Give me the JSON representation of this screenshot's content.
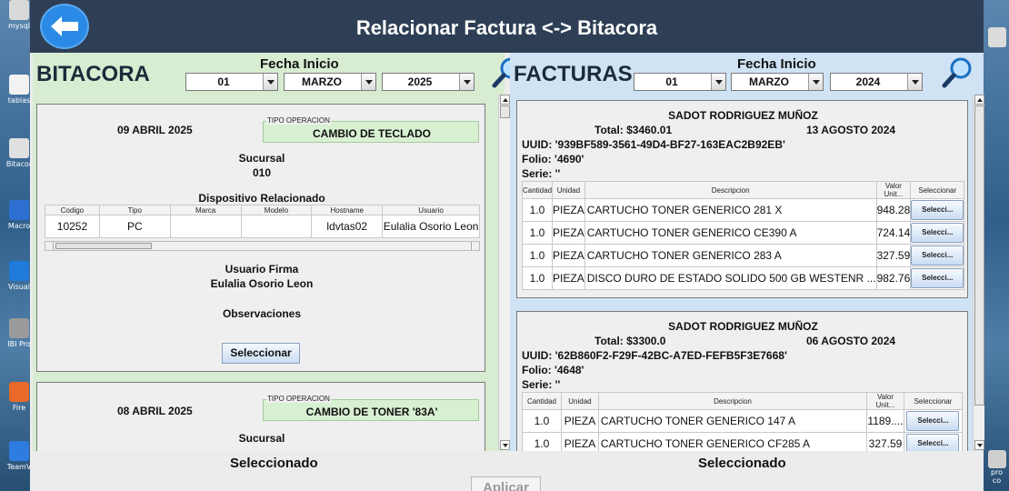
{
  "window": {
    "title": "Relacionar Factura <-> Bitacora"
  },
  "desktop_icons": [
    "mysql",
    "tablas",
    "Bitacor",
    "Macro",
    "Visual",
    "IBI Pro",
    "Fire",
    "TeamV"
  ],
  "right_icons": [
    "pro",
    "co"
  ],
  "bitacora": {
    "header": "BITACORA",
    "fecha_label": "Fecha Inicio",
    "day": "01",
    "month": "MARZO",
    "year": "2025",
    "entries": [
      {
        "date": "09 ABRIL 2025",
        "op_label": "TIPO OPERACION",
        "op_value": "CAMBIO DE TECLADO",
        "sucursal_label": "Sucursal",
        "sucursal_value": "010",
        "disp_label": "Dispositivo Relacionado",
        "columns": [
          "Codigo",
          "Tipo",
          "Marca",
          "Modelo",
          "Hostname",
          "Usuario"
        ],
        "row": [
          "10252",
          "PC",
          "",
          "",
          "ldvtas02",
          "Eulalia Osorio Leon"
        ],
        "usuario_firma_label": "Usuario Firma",
        "usuario_firma_value": "Eulalia Osorio Leon",
        "observaciones_label": "Observaciones",
        "select_label": "Seleccionar"
      },
      {
        "date": "08 ABRIL 2025",
        "op_label": "TIPO OPERACION",
        "op_value": "CAMBIO DE TONER '83A'",
        "sucursal_label": "Sucursal"
      }
    ],
    "selected_label": "Seleccionado"
  },
  "facturas": {
    "header": "FACTURAS",
    "fecha_label": "Fecha Inicio",
    "day": "01",
    "month": "MARZO",
    "year": "2024",
    "columns": [
      "Cantidad",
      "Unidad",
      "Descripcion",
      "Valor Unit...",
      "Seleccionar"
    ],
    "invoices": [
      {
        "name": "SADOT RODRIGUEZ MUÑOZ",
        "total": "Total: $3460.01",
        "date": "13 AGOSTO 2024",
        "uuid": "UUID: '939BF589-3561-49D4-BF27-163EAC2B92EB'",
        "folio": "Folio: '4690'",
        "serie": "Serie: ''",
        "items": [
          {
            "qty": "1.0",
            "unit": "PIEZA",
            "desc": "CARTUCHO TONER GENERICO  281 X",
            "val": "948.28",
            "btn": "Selecci..."
          },
          {
            "qty": "1.0",
            "unit": "PIEZA",
            "desc": "CARTUCHO TONER GENERICO  CE390 A",
            "val": "724.14",
            "btn": "Selecci..."
          },
          {
            "qty": "1.0",
            "unit": "PIEZA",
            "desc": "CARTUCHO TONER GENERICO  283 A",
            "val": "327.59",
            "btn": "Selecci..."
          },
          {
            "qty": "1.0",
            "unit": "PIEZA",
            "desc": "DISCO DURO DE ESTADO SOLIDO 500 GB  WESTENR ...",
            "val": "982.76",
            "btn": "Selecci..."
          }
        ]
      },
      {
        "name": "SADOT RODRIGUEZ MUÑOZ",
        "total": "Total: $3300.0",
        "date": "06 AGOSTO 2024",
        "uuid": "UUID: '62B860F2-F29F-42BC-A7ED-FEFB5F3E7668'",
        "folio": "Folio: '4648'",
        "serie": "Serie: ''",
        "items": [
          {
            "qty": "1.0",
            "unit": "PIEZA",
            "desc": "CARTUCHO TONER GENERICO 147 A",
            "val": "1189....",
            "btn": "Selecci..."
          },
          {
            "qty": "1.0",
            "unit": "PIEZA",
            "desc": "CARTUCHO TONER GENERICO CF285 A",
            "val": "327.59",
            "btn": "Selecci..."
          }
        ]
      }
    ],
    "selected_label": "Seleccionado"
  },
  "apply_label": "Aplicar"
}
